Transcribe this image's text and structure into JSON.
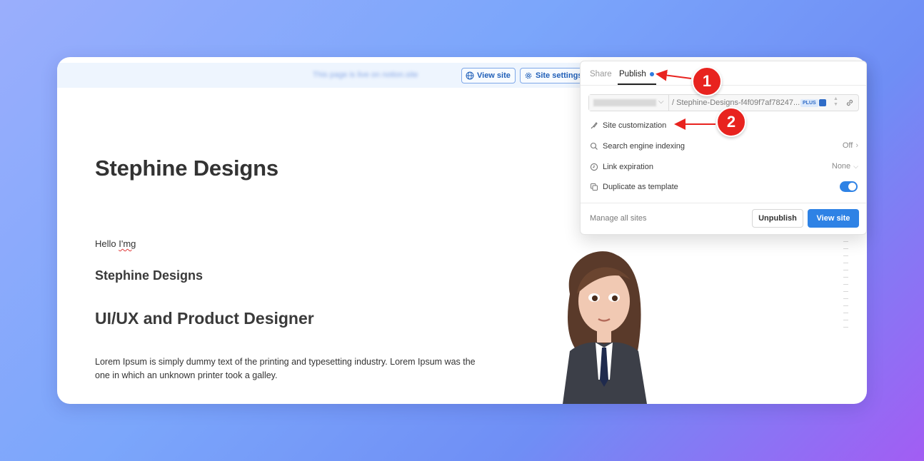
{
  "topbar": {
    "blurred_notice": "This page is live on notion.site",
    "view_site_label": "View site",
    "site_settings_label": "Site settings"
  },
  "page": {
    "title": "Stephine Designs",
    "hello_prefix": "Hello ",
    "hello_word": "I'mg",
    "subtitle": "Stephine Designs",
    "role": "UI/UX and Product Designer",
    "body": "Lorem Ipsum is simply dummy text of the printing and typesetting industry. Lorem Ipsum was the one in which an unknown printer took a galley."
  },
  "panel": {
    "tabs": {
      "share": "Share",
      "publish": "Publish"
    },
    "url_text": "/ Stephine-Designs-f4f09f7af78247...",
    "plus_badge": "PLUS",
    "rows": {
      "site_customization": "Site customization",
      "search_indexing": "Search engine indexing",
      "search_indexing_value": "Off",
      "link_expiration": "Link expiration",
      "link_expiration_value": "None",
      "duplicate_template": "Duplicate as template"
    },
    "footer": {
      "manage": "Manage all sites",
      "unpublish": "Unpublish",
      "view_site": "View site"
    }
  },
  "callouts": {
    "one": "1",
    "two": "2"
  },
  "colors": {
    "accent": "#2e82e5",
    "callout": "#e8231f",
    "topbar_bg": "#eef5fe"
  },
  "duplicate_template_enabled": true
}
